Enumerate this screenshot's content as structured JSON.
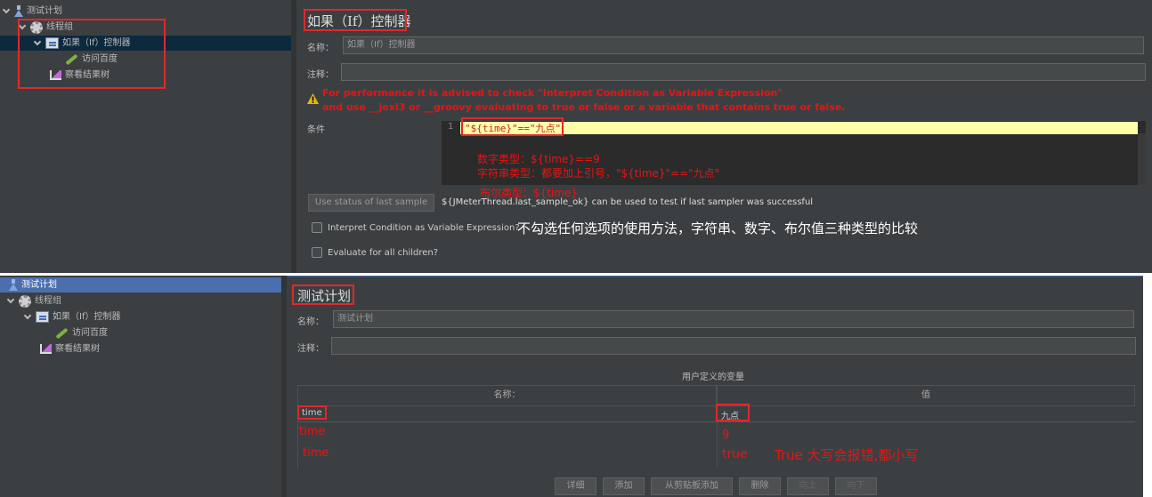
{
  "top": {
    "tree": {
      "root": "测试计划",
      "thread_group": "线程组",
      "if_controller": "如果（If）控制器",
      "sampler": "访问百度",
      "listener": "察看结果树"
    },
    "panel_title": "如果（If）控制器",
    "name_label": "名称：",
    "name_value": "如果（If）控制器",
    "comment_label": "注释：",
    "comment_value": "",
    "warning_line1": "For performance it is advised to check \"Interpret Condition as Variable Expression\"",
    "warning_line2": "and use __jexl3 or __groovy evaluating to true or false or a variable that contains true or false.",
    "condition_label": "条件",
    "line_number": "1",
    "condition_code": "\"${time}\"==\"九点\"",
    "note_number": "数字类型：${time}==9",
    "note_string": "字符串类型：都要加上引号，\"${time}\"==\"九点\"",
    "note_boolean": "布尔类型：${time}",
    "use_status_button": "Use status of last sample",
    "status_hint": "${JMeterThread.last_sample_ok} can be used to test if last sampler was successful",
    "interpret_label": "Interpret Condition as Variable Expression?",
    "interpret_note": "不勾选任何选项的使用方法，字符串、数字、布尔值三种类型的比较",
    "evaluate_label": "Evaluate for all children?"
  },
  "bottom": {
    "tree": {
      "root": "测试计划",
      "thread_group": "线程组",
      "if_controller": "如果（If）控制器",
      "sampler": "访问百度",
      "listener": "察看结果树"
    },
    "panel_title": "测试计划",
    "name_label": "名称：",
    "name_value": "测试计划",
    "comment_label": "注释：",
    "comment_value": "",
    "table_title": "用户定义的变量",
    "col_name": "名称：",
    "col_value": "值",
    "row_name": "time",
    "row_value": "九点",
    "alt_name_1": "time",
    "alt_value_1": "9",
    "alt_name_2": "time",
    "alt_value_2": "true",
    "note_true": "True 大写会报错,都小写",
    "buttons": {
      "detail": "详细",
      "add": "添加",
      "paste": "从剪贴板添加",
      "delete": "删除",
      "up": "向上",
      "down": "向下"
    }
  },
  "colors": {
    "bg": "#3c3f41",
    "selection": "#0d293e",
    "selection_alt": "#4b6eaf",
    "highlight_line": "#ffffaa",
    "red": "#e81414"
  }
}
